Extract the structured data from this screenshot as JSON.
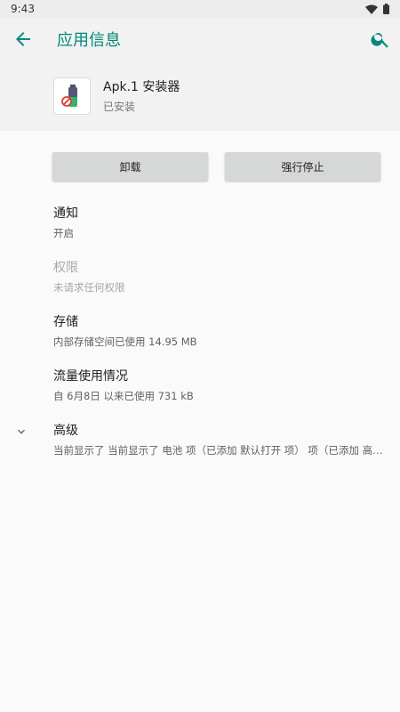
{
  "statusbar": {
    "time": "9:43"
  },
  "appbar": {
    "title": "应用信息"
  },
  "app": {
    "name": "Apk.1 安装器",
    "status": "已安装"
  },
  "buttons": {
    "uninstall": "卸载",
    "force_stop": "强行停止"
  },
  "items": [
    {
      "title": "通知",
      "summary": "开启"
    },
    {
      "title": "权限",
      "summary": "未请求任何权限"
    },
    {
      "title": "存储",
      "summary": "内部存储空间已使用 14.95 MB"
    },
    {
      "title": "流量使用情况",
      "summary": "自 6月8日 以来已使用 731 kB"
    },
    {
      "title": "高级",
      "summary": "当前显示了 当前显示了 电池 项（已添加 默认打开 项） 项（已添加 高级.."
    }
  ],
  "colors": {
    "accent": "#00897b",
    "background": "#fafafa",
    "button": "#d6d7d7"
  }
}
